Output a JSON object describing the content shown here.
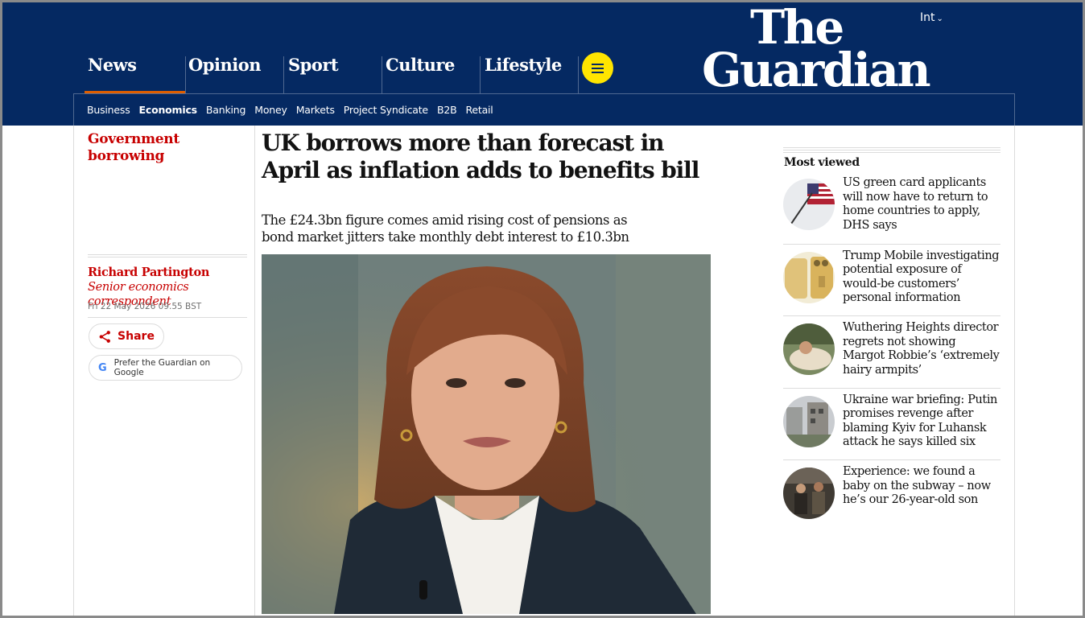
{
  "header": {
    "edition": "Int",
    "logo_line1": "The",
    "logo_line2": "Guardian",
    "pillars": [
      "News",
      "Opinion",
      "Sport",
      "Culture",
      "Lifestyle"
    ],
    "subnav": [
      "Business",
      "Economics",
      "Banking",
      "Money",
      "Markets",
      "Project Syndicate",
      "B2B",
      "Retail"
    ],
    "subnav_current": "Economics"
  },
  "article": {
    "kicker": "Government borrowing",
    "headline": "UK borrows more than forecast in April as inflation adds to benefits bill",
    "standfirst": "The £24.3bn figure comes amid rising cost of pensions as bond market jitters take monthly debt interest to £10.3bn",
    "author_name": "Richard Partington",
    "author_role": "Senior economics correspondent",
    "date": "Fri 22 May 2026 09.55 BST",
    "share_label": "Share",
    "google_label": "Prefer the Guardian on Google"
  },
  "most_viewed": {
    "title": "Most viewed",
    "items": [
      "US green card applicants will now have to return to home countries to apply, DHS says",
      "Trump Mobile investigating potential exposure of would-be customers’ personal information",
      "Wuthering Heights director regrets not showing Margot Robbie’s ‘extremely hairy armpits’",
      "Ukraine war briefing: Putin promises revenge after blaming Kyiv for Luhansk attack he says killed six",
      "Experience: we found a baby on the subway – now he’s our 26-year-old son"
    ]
  },
  "colors": {
    "brand_blue": "#052962",
    "news_red": "#c70000",
    "news_accent": "#e05e00",
    "menu_yellow": "#ffe500"
  }
}
